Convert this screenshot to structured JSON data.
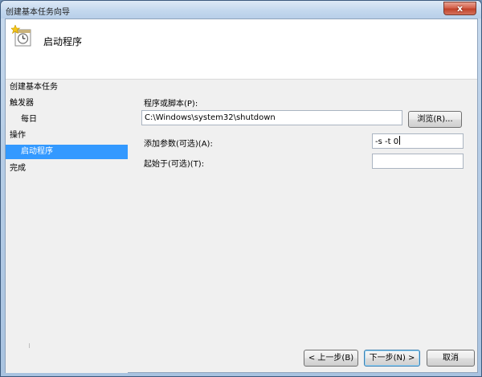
{
  "window": {
    "title": "创建基本任务向导",
    "close_label": "x"
  },
  "header": {
    "title": "启动程序",
    "icon": "task-scheduler-clock-icon"
  },
  "nav": {
    "items": [
      {
        "label": "创建基本任务",
        "indent": 0,
        "selected": false
      },
      {
        "label": "触发器",
        "indent": 0,
        "selected": false
      },
      {
        "label": "每日",
        "indent": 1,
        "selected": false
      },
      {
        "label": "操作",
        "indent": 0,
        "selected": false
      },
      {
        "label": "启动程序",
        "indent": 1,
        "selected": true
      },
      {
        "label": "完成",
        "indent": 0,
        "selected": false
      }
    ]
  },
  "form": {
    "program_label": "程序或脚本(P):",
    "program_value": "C:\\Windows\\system32\\shutdown",
    "browse_label": "浏览(R)...",
    "args_label": "添加参数(可选)(A):",
    "args_value": "-s -t 0",
    "startin_label": "起始于(可选)(T):",
    "startin_value": ""
  },
  "footer": {
    "back_label": "< 上一步(B)",
    "next_label": "下一步(N) >",
    "cancel_label": "取消"
  },
  "colors": {
    "selection": "#3399ff",
    "title_bar": "#c4d8ee",
    "close_button": "#c0422a"
  }
}
